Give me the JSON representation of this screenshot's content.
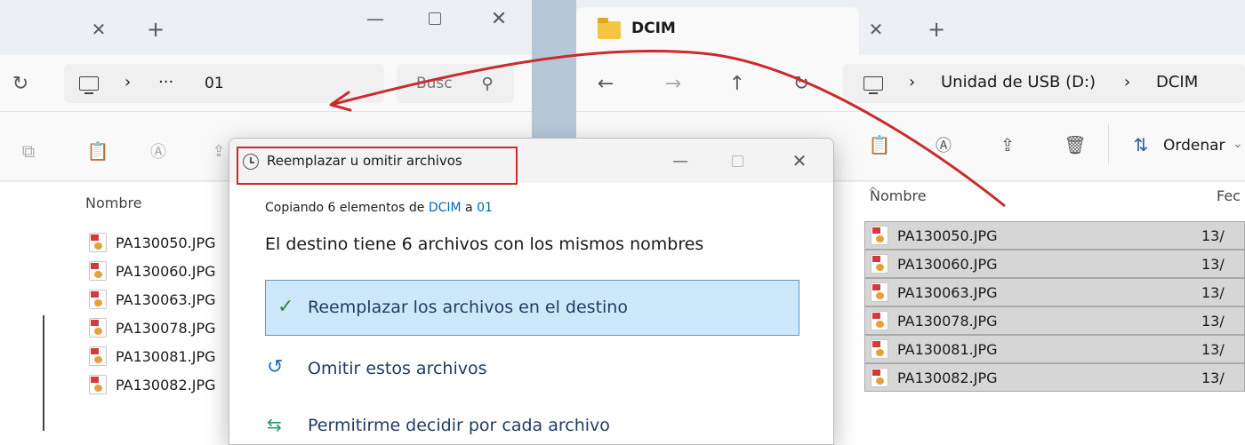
{
  "left_window": {
    "nav": {
      "path_ellipsis": "···",
      "path_current": "01",
      "search_placeholder": "Busc"
    },
    "content": {
      "column_name": "Nombre",
      "files": [
        "PA130050.JPG",
        "PA130060.JPG",
        "PA130063.JPG",
        "PA130078.JPG",
        "PA130081.JPG",
        "PA130082.JPG"
      ]
    }
  },
  "right_window": {
    "tab_title": "DCIM",
    "breadcrumb": {
      "drive": "Unidad de USB (D:)",
      "folder": "DCIM"
    },
    "toolbar": {
      "sort_label": "Ordenar"
    },
    "content": {
      "column_name": "Nombre",
      "column_date": "Fec",
      "files": [
        {
          "name": "PA130050.JPG",
          "date": "13/"
        },
        {
          "name": "PA130060.JPG",
          "date": "13/"
        },
        {
          "name": "PA130063.JPG",
          "date": "13/"
        },
        {
          "name": "PA130078.JPG",
          "date": "13/"
        },
        {
          "name": "PA130081.JPG",
          "date": "13/"
        },
        {
          "name": "PA130082.JPG",
          "date": "13/"
        }
      ]
    }
  },
  "dialog": {
    "title": "Reemplazar u omitir archivos",
    "copying_prefix": "Copiando 6 elementos de",
    "copying_source": "DCIM",
    "copying_middle": "a",
    "copying_dest": "01",
    "heading": "El destino tiene 6 archivos con los mismos nombres",
    "options": {
      "replace": "Reemplazar los archivos en el destino",
      "skip": "Omitir estos archivos",
      "decide": "Permitirme decidir por cada archivo"
    }
  },
  "colors": {
    "accent": "#0067c0",
    "annotation_red": "#cc2b2b",
    "selected_option_bg": "#cde8fb",
    "check_green": "#2e8b3d"
  },
  "icons": [
    "close-icon",
    "new-tab-icon",
    "minimize-icon",
    "maximize-icon",
    "refresh-icon",
    "computer-icon",
    "chevron-right-icon",
    "search-icon",
    "copy-icon",
    "paste-icon",
    "rename-icon",
    "share-icon",
    "delete-icon",
    "sort-icon",
    "back-icon",
    "forward-icon",
    "up-icon",
    "folder-icon",
    "clock-icon",
    "check-icon",
    "undo-icon",
    "decide-icon",
    "image-file-icon"
  ]
}
